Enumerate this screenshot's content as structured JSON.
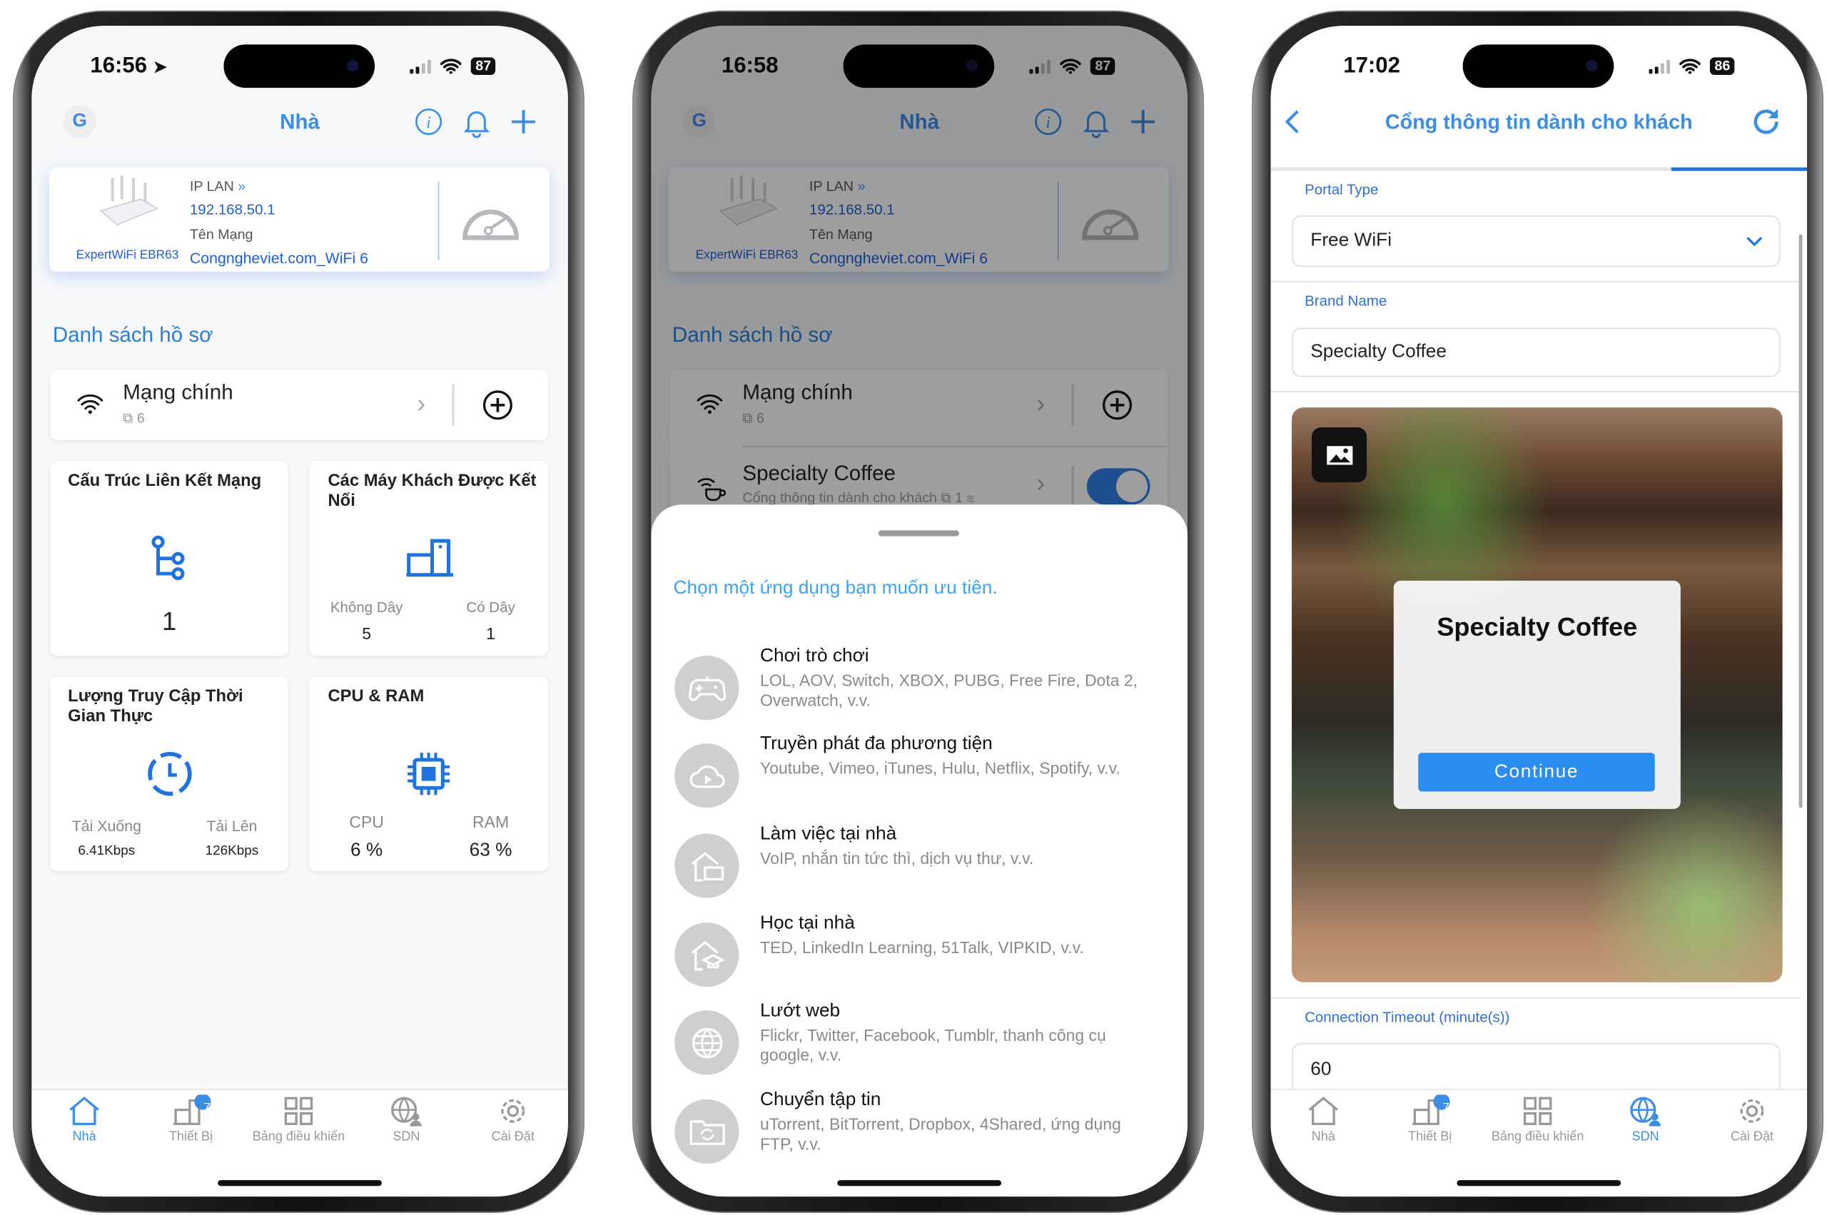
{
  "home": {
    "title": "Nhà",
    "router": {
      "ip_label": "IP LAN",
      "ip_value": "192.168.50.1",
      "network_label": "Tên Mạng",
      "network_value": "Congngheviet.com_WiFi 6",
      "model": "ExpertWiFi EBR63"
    },
    "profiles_heading": "Danh sách hồ sơ",
    "profiles": [
      {
        "name": "Mạng chính",
        "devices": "6"
      },
      {
        "name": "Specialty Coffee",
        "subtitle": "Cổng thông tin dành cho khách",
        "devices": "1",
        "enabled": true
      }
    ],
    "cards": {
      "topology": {
        "title": "Cấu Trúc Liên Kết Mạng",
        "value": "1"
      },
      "clients": {
        "title": "Các Máy Khách Được Kết Nối",
        "wireless_label": "Không Dây",
        "wireless_value": "5",
        "wired_label": "Có Dây",
        "wired_value": "1"
      },
      "traffic": {
        "title": "Lượng Truy Cập Thời Gian Thực",
        "down_label": "Tải Xuống",
        "down_value": "6.41Kbps",
        "up_label": "Tải Lên",
        "up_value": "126Kbps"
      },
      "cpu_ram": {
        "title": "CPU & RAM",
        "cpu_label": "CPU",
        "cpu_value": "6 %",
        "ram_label": "RAM",
        "ram_value": "63 %"
      }
    }
  },
  "tabs": [
    {
      "label": "Nhà",
      "icon": "home-icon"
    },
    {
      "label": "Thiết Bị",
      "icon": "devices-icon",
      "badge": "7"
    },
    {
      "label": "Bảng điều khiển",
      "icon": "dashboard-icon"
    },
    {
      "label": "SDN",
      "icon": "sdn-globe-icon"
    },
    {
      "label": "Cài Đặt",
      "icon": "settings-gear-icon"
    }
  ],
  "phone1": {
    "time": "16:56",
    "battery": "87",
    "active_tab": "Nhà"
  },
  "phone2": {
    "time": "16:58",
    "battery": "87",
    "sheet": {
      "heading": "Chọn một ứng dụng bạn muốn ưu tiên.",
      "items": [
        {
          "title": "Chơi trò chơi",
          "desc": "LOL, AOV, Switch, XBOX, PUBG, Free Fire, Dota 2, Overwatch, v.v.",
          "icon": "gamepad-icon"
        },
        {
          "title": "Truyền phát đa phương tiện",
          "desc": "Youtube, Vimeo, iTunes, Hulu, Netflix, Spotify, v.v.",
          "icon": "cloud-play-icon"
        },
        {
          "title": "Làm việc tại nhà",
          "desc": "VoIP, nhắn tin tức thì, dịch vụ thư, v.v.",
          "icon": "home-briefcase-icon"
        },
        {
          "title": "Học tại nhà",
          "desc": "TED, LinkedIn Learning, 51Talk, VIPKID, v.v.",
          "icon": "home-graduation-icon"
        },
        {
          "title": "Lướt web",
          "desc": "Flickr, Twitter, Facebook, Tumblr, thanh công cụ google, v.v.",
          "icon": "globe-icon"
        },
        {
          "title": "Chuyển tập tin",
          "desc": "uTorrent, BitTorrent, Dropbox, 4Shared, ứng dụng FTP, v.v.",
          "icon": "folder-sync-icon"
        }
      ]
    }
  },
  "phone3": {
    "time": "17:02",
    "battery": "86",
    "active_tab": "SDN",
    "title": "Cổng thông tin dành cho khách",
    "portal_type_label": "Portal Type",
    "portal_type_value": "Free WiFi",
    "brand_name_label": "Brand Name",
    "brand_name_value": "Specialty Coffee",
    "preview": {
      "title": "Specialty Coffee",
      "button": "Continue"
    },
    "timeout_label": "Connection Timeout (minute(s))",
    "timeout_value": "60"
  },
  "colors": {
    "accent": "#3a8ee6",
    "link": "#1f5fd6",
    "button": "#2b8df0"
  }
}
